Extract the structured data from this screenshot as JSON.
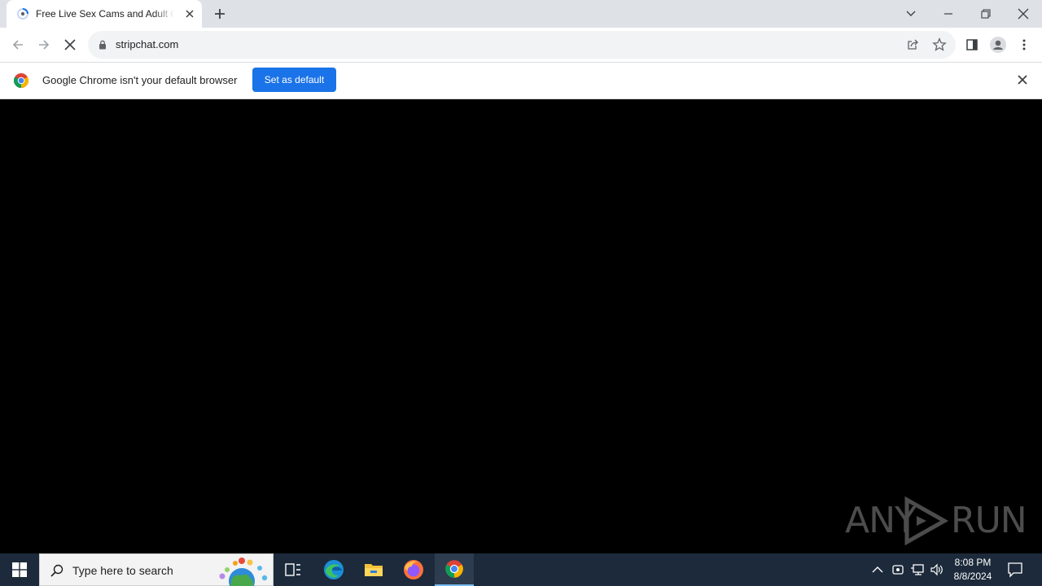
{
  "tab": {
    "title": "Free Live Sex Cams and Adult Chat",
    "favicon": "loading-spinner-icon"
  },
  "window_controls": [
    "minimize-icon",
    "restore-icon",
    "close-icon"
  ],
  "omnibox": {
    "url": "stripchat.com"
  },
  "infobar": {
    "message": "Google Chrome isn't your default browser",
    "button_label": "Set as default"
  },
  "watermark": {
    "left": "ANY",
    "right": "RUN"
  },
  "taskbar": {
    "search_placeholder": "Type here to search",
    "apps": [
      "task-view-icon",
      "edge-icon",
      "file-explorer-icon",
      "firefox-icon",
      "chrome-icon"
    ],
    "clock_time": "8:08 PM",
    "clock_date": "8/8/2024"
  },
  "colors": {
    "tabstrip": "#dee1e6",
    "accent": "#1a73e8",
    "taskbar": "#1c2a3b"
  }
}
